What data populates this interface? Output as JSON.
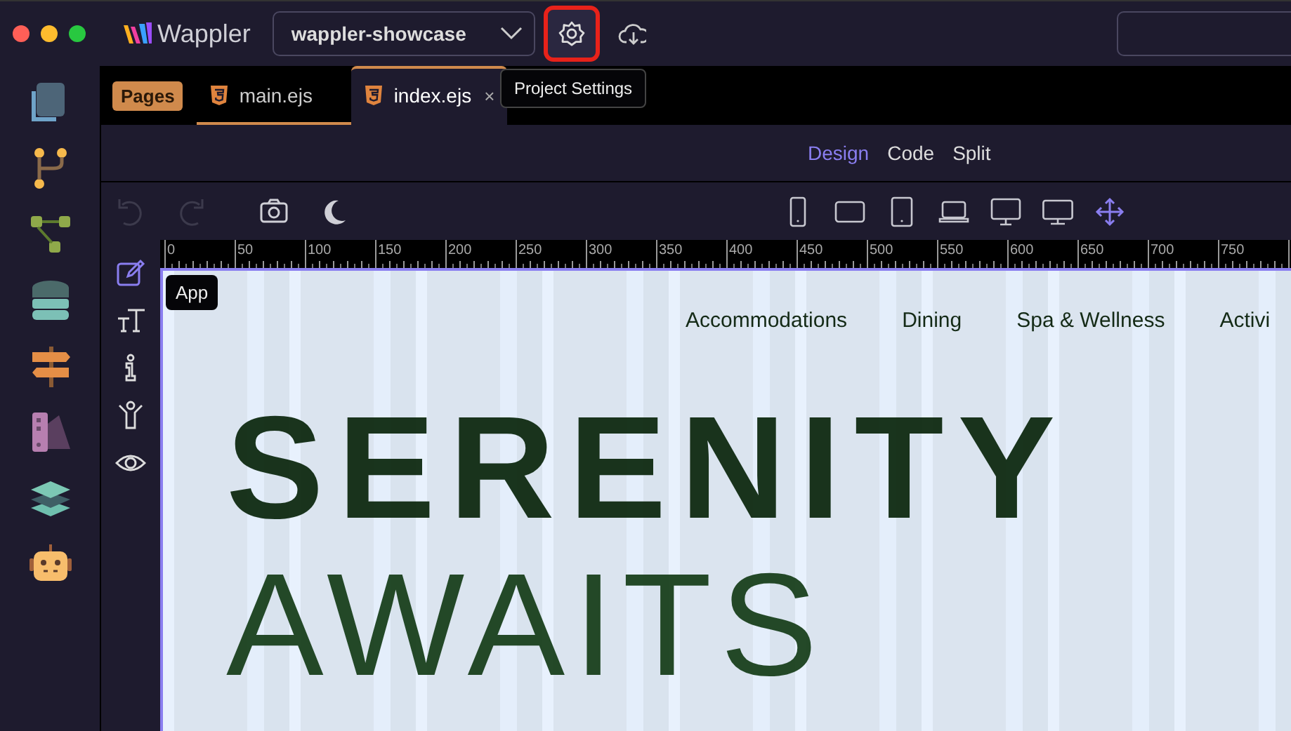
{
  "window": {
    "app_name": "Wappler"
  },
  "project_select": {
    "value": "wappler-showcase"
  },
  "top_buttons": [
    {
      "kind": "settings",
      "highlighted": true,
      "tooltip": "Project Settings"
    },
    {
      "kind": "cloud",
      "highlighted": false
    }
  ],
  "sidebar": {
    "items": [
      {
        "kind": "pages"
      },
      {
        "kind": "branch"
      },
      {
        "kind": "flow"
      },
      {
        "kind": "database"
      },
      {
        "kind": "signpost"
      },
      {
        "kind": "palette"
      },
      {
        "kind": "layers"
      },
      {
        "kind": "robot"
      }
    ]
  },
  "tabs": {
    "badge": "Pages",
    "items": [
      {
        "label": "main.ejs",
        "selected": false
      },
      {
        "label": "index.ejs",
        "selected": true,
        "close": "×"
      }
    ]
  },
  "view_modes": [
    {
      "label": "Design",
      "selected": true
    },
    {
      "label": "Code",
      "selected": false
    },
    {
      "label": "Split",
      "selected": false
    }
  ],
  "edit_toolbar": {
    "buttons": [
      {
        "kind": "undo",
        "disabled": true
      },
      {
        "kind": "redo",
        "disabled": true
      },
      {
        "kind": "camera",
        "disabled": false
      },
      {
        "kind": "moon",
        "disabled": false
      }
    ],
    "devices": [
      {
        "kind": "phone",
        "selected": false
      },
      {
        "kind": "tablet-landscape",
        "selected": false
      },
      {
        "kind": "tablet",
        "selected": false
      },
      {
        "kind": "laptop",
        "selected": false
      },
      {
        "kind": "desktop",
        "selected": false
      },
      {
        "kind": "wide",
        "selected": false
      },
      {
        "kind": "free",
        "selected": true
      }
    ]
  },
  "tools": [
    {
      "kind": "edit",
      "selected": true
    },
    {
      "kind": "text",
      "selected": false
    },
    {
      "kind": "info",
      "selected": false
    },
    {
      "kind": "person",
      "selected": false
    },
    {
      "kind": "eye",
      "selected": false
    }
  ],
  "ruler": {
    "labels": [
      "0",
      "50",
      "100",
      "150",
      "200",
      "250",
      "300",
      "350",
      "400",
      "450",
      "500",
      "550",
      "600",
      "650",
      "700",
      "750"
    ]
  },
  "canvas": {
    "element_label": "App",
    "nav": [
      "Accommodations",
      "Dining",
      "Spa & Wellness",
      "Activi"
    ],
    "headline": "SERENITY",
    "subheadline": "AWAITS"
  }
}
